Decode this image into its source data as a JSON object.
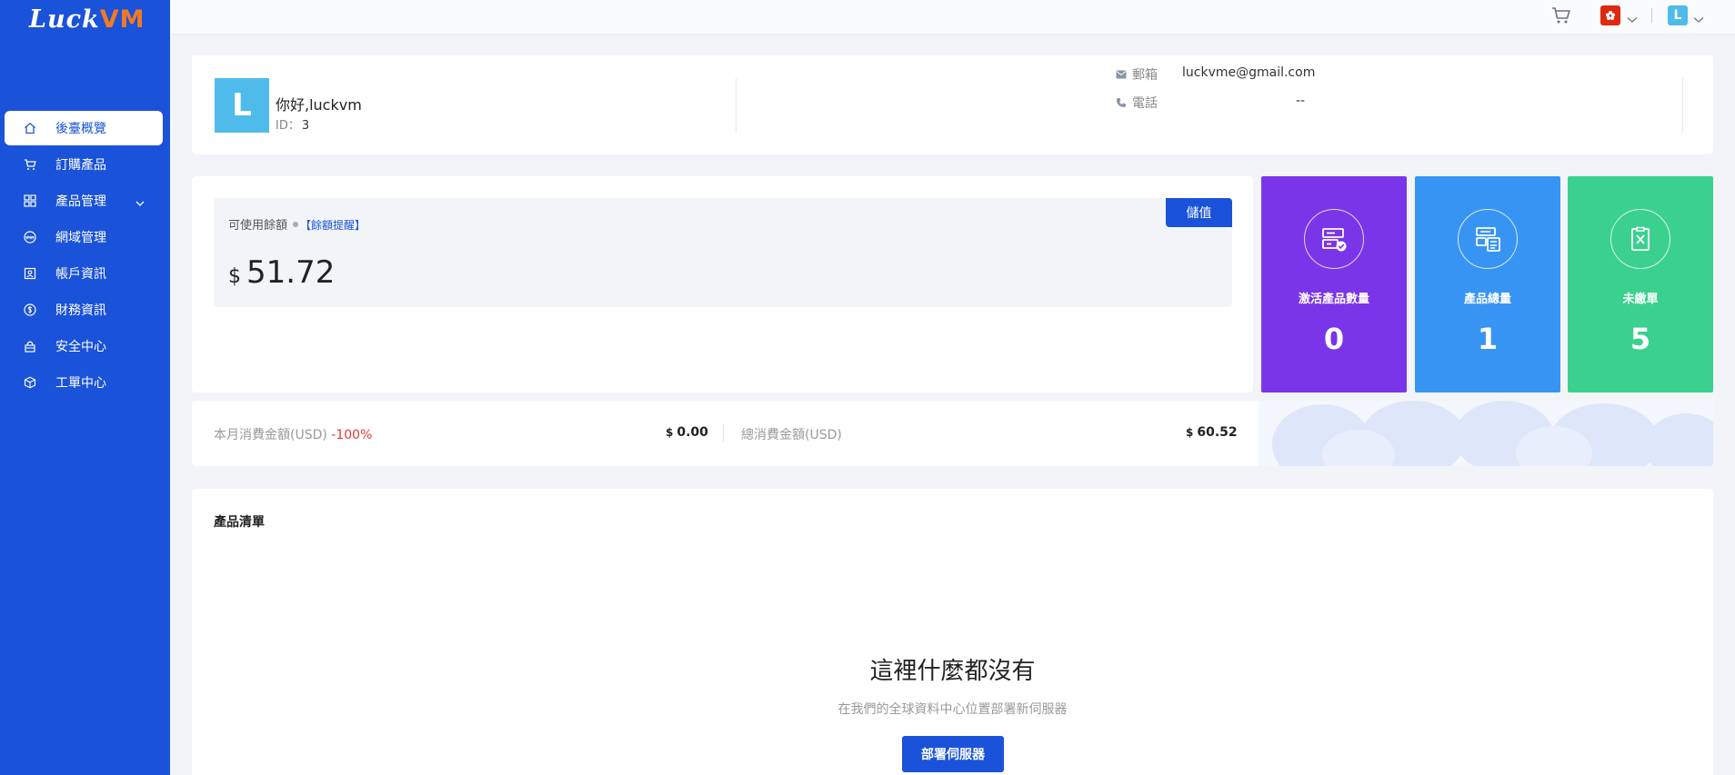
{
  "brand": {
    "name_main": "Luck",
    "name_accent": "VM"
  },
  "sidebar": {
    "items": [
      {
        "label": "後臺概覽",
        "icon": "home-icon",
        "active": true
      },
      {
        "label": "訂購產品",
        "icon": "cart-icon"
      },
      {
        "label": "產品管理",
        "icon": "grid-icon",
        "expandable": true
      },
      {
        "label": "網域管理",
        "icon": "www-icon"
      },
      {
        "label": "帳戶資訊",
        "icon": "user-card-icon"
      },
      {
        "label": "財務資訊",
        "icon": "money-icon"
      },
      {
        "label": "安全中心",
        "icon": "lock-icon"
      },
      {
        "label": "工單中心",
        "icon": "box-icon"
      }
    ]
  },
  "topbar": {
    "user_initial": "L",
    "language_flag": "hong-kong-flag"
  },
  "profile": {
    "avatar_initial": "L",
    "greeting": "你好,luckvm",
    "id_label": "ID：",
    "id_value": "3",
    "email_label": "郵箱",
    "email_value": "luckvme@gmail.com",
    "phone_label": "電話",
    "phone_value": "--"
  },
  "balance": {
    "label": "可使用餘額",
    "reminder_link": "【餘額提醒】",
    "currency": "$",
    "amount": "51.72",
    "recharge_button": "儲值"
  },
  "stats": [
    {
      "label": "激活產品數量",
      "value": "0",
      "color": "#7b35e8",
      "icon": "server-check-icon"
    },
    {
      "label": "產品總量",
      "value": "1",
      "color": "#3794f3",
      "icon": "server-list-icon"
    },
    {
      "label": "未繳單",
      "value": "5",
      "color": "#3cd08f",
      "icon": "invoice-x-icon"
    }
  ],
  "spending": {
    "month_label": "本月消費金額(USD)",
    "month_change": "-100%",
    "month_currency": "$",
    "month_value": "0.00",
    "total_label": "總消費金額(USD)",
    "total_currency": "$",
    "total_value": "60.52"
  },
  "products": {
    "title": "產品清單",
    "empty_title": "這裡什麼都沒有",
    "empty_subtitle": "在我們的全球資料中心位置部署新伺服器",
    "deploy_button": "部署伺服器"
  },
  "colors": {
    "primary": "#1a53d9",
    "accent": "#f47a20",
    "background": "#f2f4f8",
    "negative": "#e53935"
  }
}
